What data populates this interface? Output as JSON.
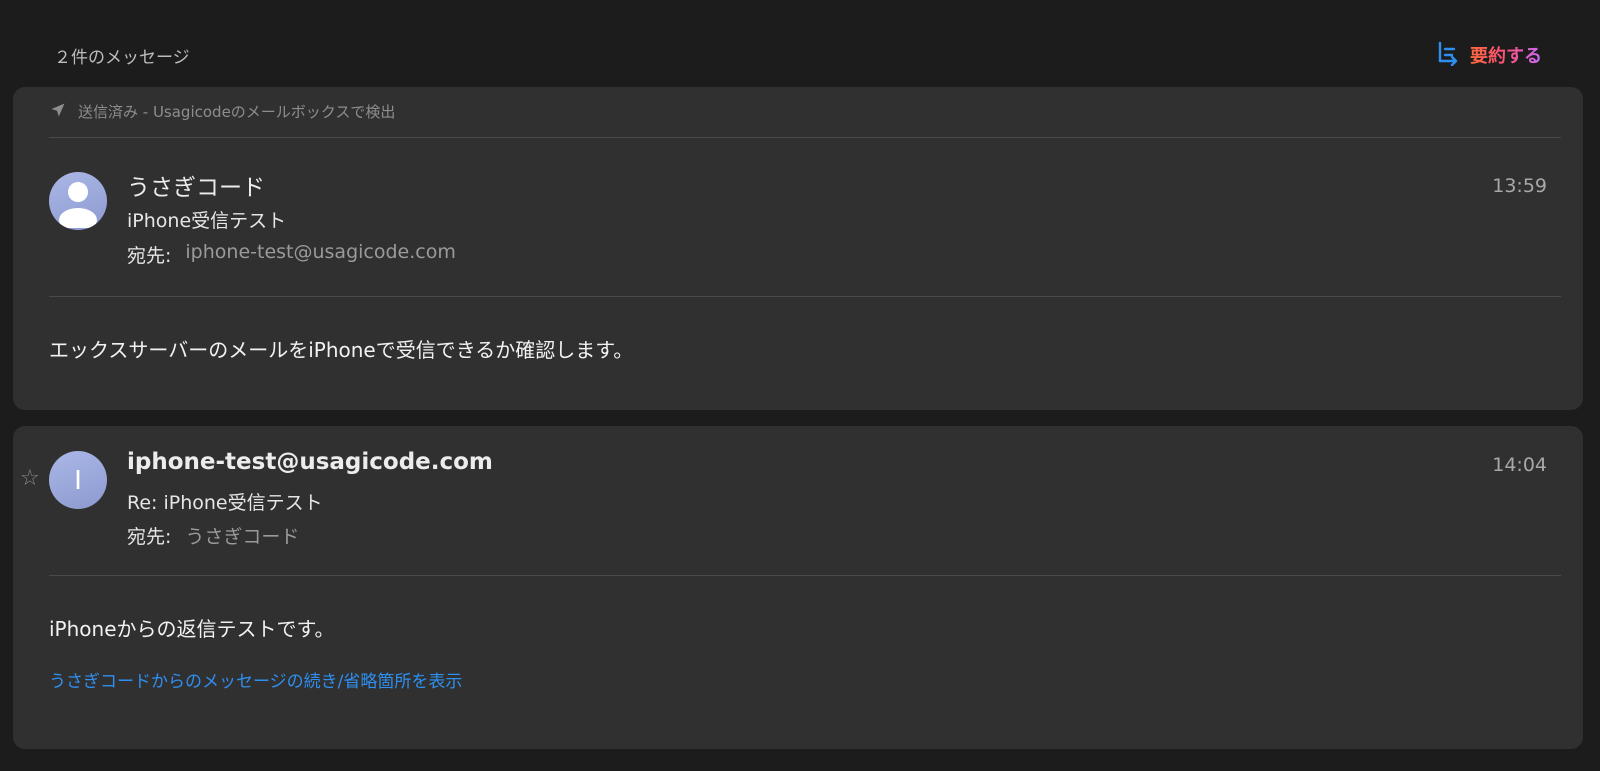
{
  "header": {
    "message_count": "２件のメッセージ",
    "summarize_label": "要約する"
  },
  "messages": [
    {
      "folder_note": "送信済み - Usagicodeのメールボックスで検出",
      "sender": "うさぎコード",
      "subject": "iPhone受信テスト",
      "recipient_label": "宛先:",
      "recipient": "iphone-test@usagicode.com",
      "time": "13:59",
      "body": "エックスサーバーのメールをiPhoneで受信できるか確認します。"
    },
    {
      "avatar_letter": "I",
      "sender": "iphone-test@usagicode.com",
      "subject": "Re: iPhone受信テスト",
      "recipient_label": "宛先:",
      "recipient": "うさぎコード",
      "time": "14:04",
      "body": "iPhoneからの返信テストです。",
      "show_more_link": "うさぎコードからのメッセージの続き/省略箇所を表示"
    }
  ],
  "colors": {
    "background": "#1c1c1c",
    "card": "#303030",
    "link": "#2f8ff0",
    "summarize_icon": "#2f8ff0"
  },
  "icons": {
    "summarize": "list-summarize-icon",
    "sent": "paper-plane-icon",
    "avatar_default": "person-icon",
    "star": "star-outline-icon"
  }
}
